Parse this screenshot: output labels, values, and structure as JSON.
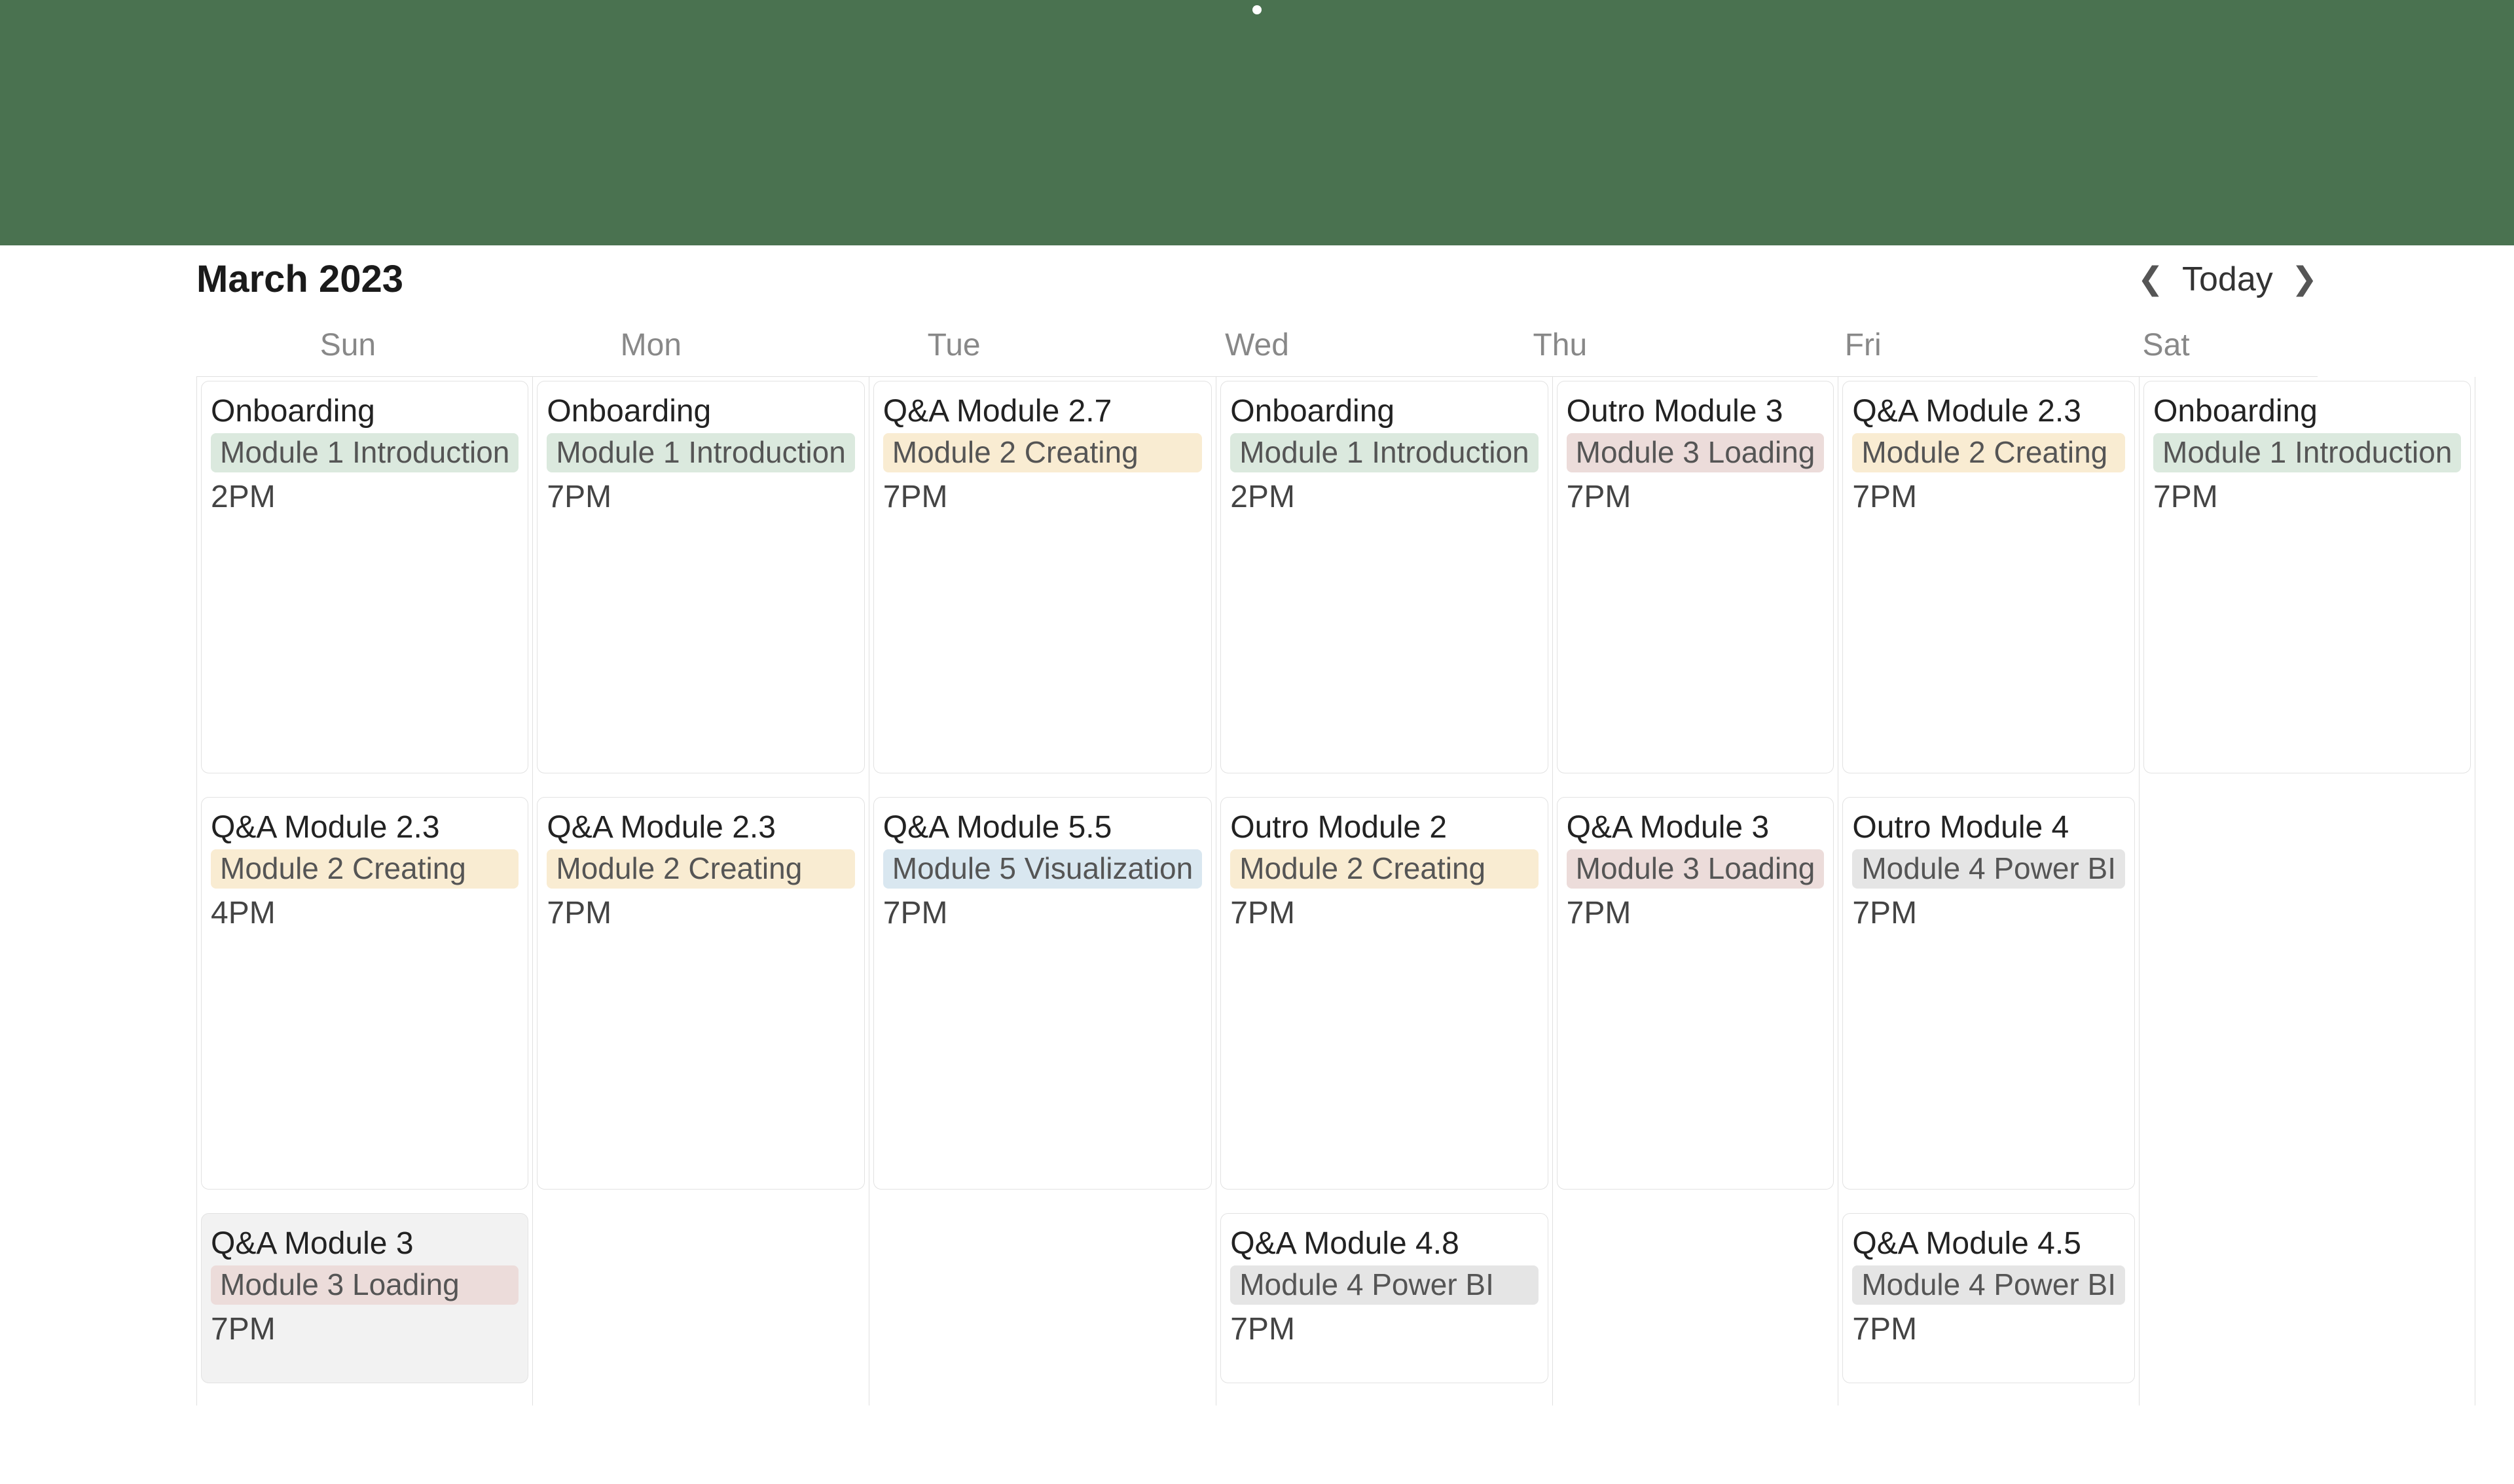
{
  "banner": {},
  "calendar": {
    "title": "March 2023",
    "today_label": "Today",
    "day_names": [
      "Sun",
      "Mon",
      "Tue",
      "Wed",
      "Thu",
      "Fri",
      "Sat"
    ]
  },
  "tag_colors": {
    "Module 1 Introduction": "tag-green",
    "Module 2 Creating": "tag-orange",
    "Module 3 Loading": "tag-pink",
    "Module 4 Power BI": "tag-gray",
    "Module 5 Visualization": "tag-blue"
  },
  "weeks": [
    {
      "days": [
        {
          "events": [
            {
              "title": "Onboarding",
              "tag": "Module 1 Introduction",
              "time": "2PM"
            }
          ]
        },
        {
          "events": [
            {
              "title": "Onboarding",
              "tag": "Module 1 Introduction",
              "time": "7PM"
            }
          ]
        },
        {
          "events": [
            {
              "title": "Q&A Module 2.7",
              "tag": "Module 2 Creating",
              "time": "7PM"
            }
          ]
        },
        {
          "events": [
            {
              "title": "Onboarding",
              "tag": "Module 1 Introduction",
              "time": "2PM"
            }
          ]
        },
        {
          "events": [
            {
              "title": "Outro Module 3",
              "tag": "Module 3 Loading",
              "time": "7PM"
            }
          ]
        },
        {
          "events": [
            {
              "title": "Q&A Module 2.3",
              "tag": "Module 2 Creating",
              "time": "7PM"
            }
          ]
        },
        {
          "events": [
            {
              "title": "Onboarding",
              "tag": "Module 1 Introduction",
              "time": "7PM"
            }
          ]
        }
      ]
    },
    {
      "days": [
        {
          "events": [
            {
              "title": "Q&A Module 2.3",
              "tag": "Module 2 Creating",
              "time": "4PM"
            }
          ]
        },
        {
          "events": [
            {
              "title": "Q&A Module 2.3",
              "tag": "Module 2 Creating",
              "time": "7PM"
            }
          ]
        },
        {
          "events": [
            {
              "title": "Q&A Module 5.5",
              "tag": "Module 5 Visualization",
              "time": "7PM"
            }
          ]
        },
        {
          "events": [
            {
              "title": "Outro Module 2",
              "tag": "Module 2 Creating",
              "time": "7PM"
            }
          ]
        },
        {
          "events": [
            {
              "title": "Q&A Module 3",
              "tag": "Module 3 Loading",
              "time": "7PM"
            }
          ]
        },
        {
          "events": [
            {
              "title": "Outro Module 4",
              "tag": "Module 4 Power BI",
              "time": "7PM"
            }
          ]
        },
        {
          "events": []
        }
      ]
    },
    {
      "days": [
        {
          "events": [
            {
              "title": "Q&A Module 3",
              "tag": "Module 3 Loading",
              "time": "7PM",
              "highlighted": true
            }
          ]
        },
        {
          "events": []
        },
        {
          "events": []
        },
        {
          "events": [
            {
              "title": "Q&A Module 4.8",
              "tag": "Module 4 Power BI",
              "time": "7PM"
            }
          ]
        },
        {
          "events": []
        },
        {
          "events": [
            {
              "title": "Q&A Module 4.5",
              "tag": "Module 4 Power BI",
              "time": "7PM"
            }
          ]
        },
        {
          "events": []
        }
      ]
    }
  ]
}
